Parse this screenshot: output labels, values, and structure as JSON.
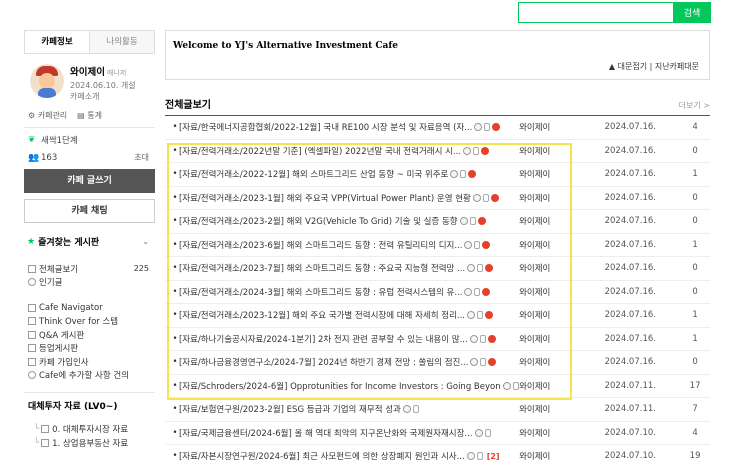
{
  "search": {
    "placeholder": "",
    "button": "검색"
  },
  "sidebar": {
    "tabs": [
      "카페정보",
      "나의활동"
    ],
    "profile": {
      "name": "와이제이",
      "role": "매니저",
      "date": "2024.06.10. 개설",
      "intro": "카페소개"
    },
    "links": [
      "카페관리",
      "통계"
    ],
    "level": "새싹1단계",
    "members": "163",
    "invite": "초대",
    "write_button": "카페 글쓰기",
    "chat_button": "카페 채팅",
    "favorites": "즐겨찾는 게시판",
    "menu1": [
      {
        "label": "전체글보기",
        "count": "225"
      },
      {
        "label": "인기글",
        "count": ""
      }
    ],
    "menu2": [
      {
        "label": "Cafe Navigator"
      },
      {
        "label": "Think Over for 스텝"
      },
      {
        "label": "Q&A 게시판"
      },
      {
        "label": "등업게시판"
      },
      {
        "label": "카페 가입인사"
      },
      {
        "label": "Cafe에 추가할 사항 건의"
      }
    ],
    "category": "대체투자 자료 (LV0~)",
    "sub": [
      {
        "label": "0. 대체투자시장 자료"
      },
      {
        "label": "1. 상업용부동산 자료"
      }
    ]
  },
  "main": {
    "welcome_title": "Welcome to YJ's Alternative Investment Cafe",
    "welcome_links": "▲ 대문접기 | 지난카페대문",
    "section_title": "전체글보기",
    "more": "더보기 >",
    "posts": [
      {
        "subject": "[자료/한국에너지공합협회/2022-12월] 국내 RE100 시장 분석 및 자료응역 (자...",
        "author": "와이제이",
        "date": "2024.07.16.",
        "views": "4",
        "new": true,
        "comments": ""
      },
      {
        "subject": "[자료/전력거래소/2022년말 기준] (엑셀파일) 2022년말 국내 전력거래시 시...",
        "author": "와이제이",
        "date": "2024.07.16.",
        "views": "0",
        "new": true,
        "comments": ""
      },
      {
        "subject": "[자료/전력거래소/2022-12월] 해외 스마트그리드 산업 동향 ~ 미국 위주로",
        "author": "와이제이",
        "date": "2024.07.16.",
        "views": "1",
        "new": true,
        "comments": ""
      },
      {
        "subject": "[자료/전력거래소/2023-1월] 해외 주요국 VPP(Virtual Power Plant) 운영 현황",
        "author": "와이제이",
        "date": "2024.07.16.",
        "views": "0",
        "new": true,
        "comments": ""
      },
      {
        "subject": "[자료/전력거래소/2023-2월] 해외 V2G(Vehicle To Grid) 기술 및 실증 동향",
        "author": "와이제이",
        "date": "2024.07.16.",
        "views": "0",
        "new": true,
        "comments": ""
      },
      {
        "subject": "[자료/전력거래소/2023-6월] 해외 스마트그리드 동향 : 전력 유틸리티의 디지...",
        "author": "와이제이",
        "date": "2024.07.16.",
        "views": "1",
        "new": true,
        "comments": ""
      },
      {
        "subject": "[자료/전력거래소/2023-7월] 해외 스마트그리드 동향 : 주요국 지능형 전력망 ...",
        "author": "와이제이",
        "date": "2024.07.16.",
        "views": "0",
        "new": true,
        "comments": ""
      },
      {
        "subject": "[자료/전력거래소/2024-3월] 해외 스마트그리드 동향 : 유럽 전력시스템의 유...",
        "author": "와이제이",
        "date": "2024.07.16.",
        "views": "0",
        "new": true,
        "comments": ""
      },
      {
        "subject": "[자료/전력거래소/2023-12월] 해외 주요 국가별 전력시장에 대해 자세히 정리...",
        "author": "와이제이",
        "date": "2024.07.16.",
        "views": "1",
        "new": true,
        "comments": ""
      },
      {
        "subject": "[자료/하나기술공시자료/2024-1분기] 2차 전지 관련 공부할 수 있는 내용이 많...",
        "author": "와이제이",
        "date": "2024.07.16.",
        "views": "1",
        "new": true,
        "comments": ""
      },
      {
        "subject": "[자료/하나금융경영연구소/2024-7월] 2024년 하반기 경제 전망 : 쏠림의 점진...",
        "author": "와이제이",
        "date": "2024.07.16.",
        "views": "0",
        "new": true,
        "comments": ""
      },
      {
        "subject": "[자료/Schroders/2024-6월] Opprotunities for Income Investors : Going Beyond ...",
        "author": "와이제이",
        "date": "2024.07.11.",
        "views": "17",
        "new": false,
        "comments": ""
      },
      {
        "subject": "[자료/보험연구원/2023-2월] ESG 등급과 기업의 재무적 성과",
        "author": "와이제이",
        "date": "2024.07.11.",
        "views": "7",
        "new": false,
        "comments": ""
      },
      {
        "subject": "[자료/국제금융센터/2024-6월] 올 해 역대 최악의 지구온난화와 국제원자재시장...",
        "author": "와이제이",
        "date": "2024.07.10.",
        "views": "4",
        "new": false,
        "comments": ""
      },
      {
        "subject": "[자료/자본시장연구원/2024-6월] 최근 사모펀드에 의한 상장폐지 원인과 시사...",
        "author": "와이제이",
        "date": "2024.07.10.",
        "views": "19",
        "new": false,
        "comments": "[2]"
      }
    ]
  },
  "colors": {
    "accent": "#03c75a",
    "highlight": "#f6e44c",
    "new_badge": "#e6402b"
  }
}
